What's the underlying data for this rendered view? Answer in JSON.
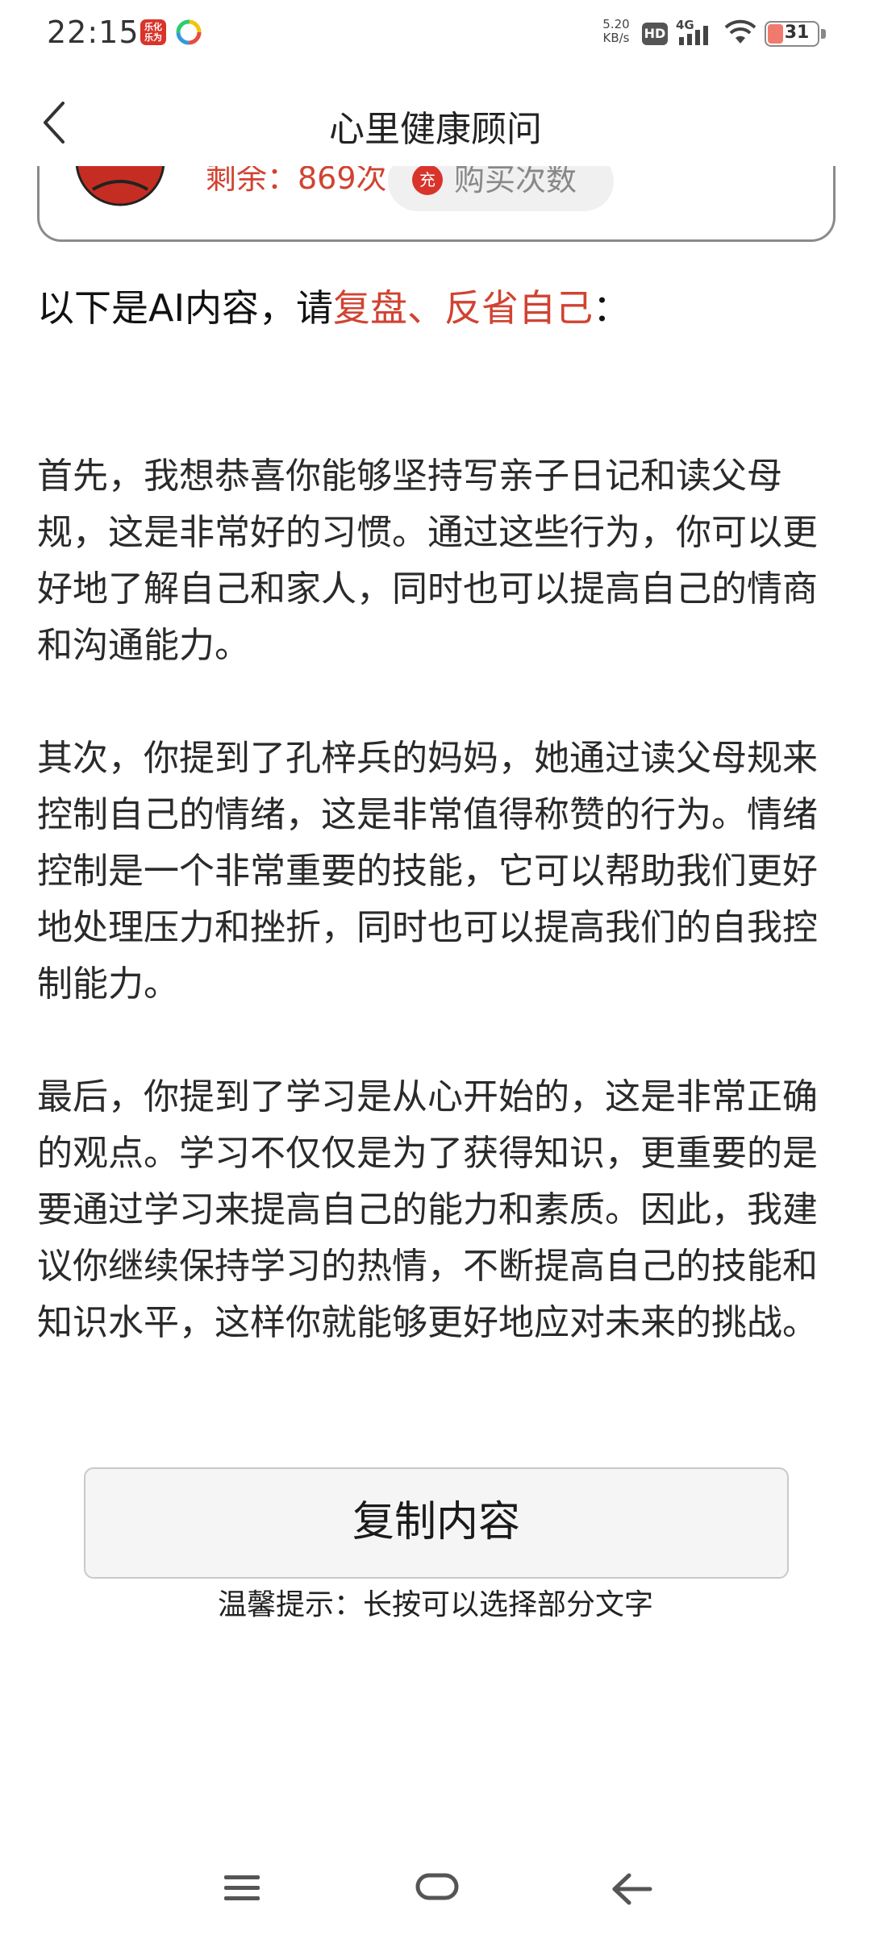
{
  "status_bar": {
    "time": "22:15",
    "app_icon_text": "乐化\n乐为",
    "net_speed_value": "5.20",
    "net_speed_unit": "KB/s",
    "hd_label": "HD",
    "signal_label": "4G",
    "battery_level": "31",
    "battery_fraction": 0.31,
    "battery_color": "#f07a6e"
  },
  "header": {
    "title": "心里健康顾问",
    "back_icon": "chevron-left-icon"
  },
  "quota_card": {
    "remaining_text": "剩余：869次",
    "buy_icon_text": "充",
    "buy_label": "购买次数"
  },
  "intro": {
    "prefix": "以下是AI内容，请",
    "highlight": "复盘、反省自己",
    "suffix": "："
  },
  "ai_content": {
    "paragraphs": [
      "首先，我想恭喜你能够坚持写亲子日记和读父母规，这是非常好的习惯。通过这些行为，你可以更好地了解自己和家人，同时也可以提高自己的情商和沟通能力。",
      "其次，你提到了孔梓兵的妈妈，她通过读父母规来控制自己的情绪，这是非常值得称赞的行为。情绪控制是一个非常重要的技能，它可以帮助我们更好地处理压力和挫折，同时也可以提高我们的自我控制能力。",
      "最后，你提到了学习是从心开始的，这是非常正确的观点。学习不仅仅是为了获得知识，更重要的是要通过学习来提高自己的能力和素质。因此，我建议你继续保持学习的热情，不断提高自己的技能和知识水平，这样你就能够更好地应对未来的挑战。"
    ]
  },
  "actions": {
    "copy_label": "复制内容",
    "copy_tip": "温馨提示：长按可以选择部分文字"
  },
  "colors": {
    "accent_red": "#d04332",
    "text_dark": "#111111"
  }
}
